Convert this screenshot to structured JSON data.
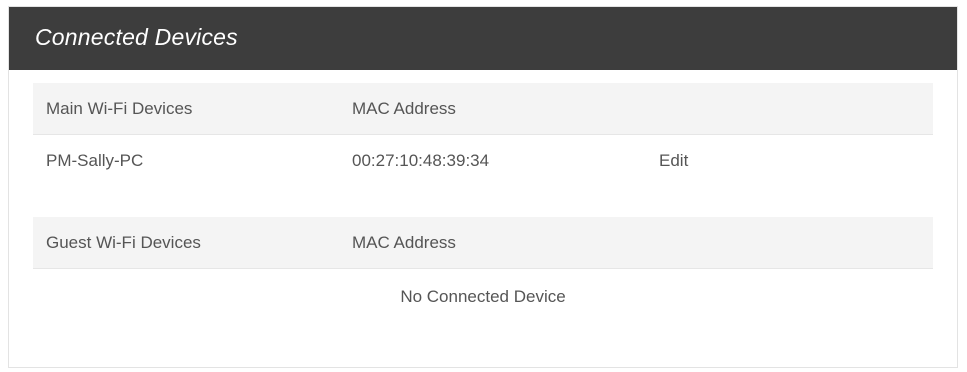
{
  "panel": {
    "title": "Connected Devices"
  },
  "main_wifi": {
    "header": {
      "device_col": "Main Wi-Fi Devices",
      "mac_col": "MAC Address"
    },
    "devices": [
      {
        "name": "PM-Sally-PC",
        "mac": "00:27:10:48:39:34",
        "action": "Edit"
      }
    ]
  },
  "guest_wifi": {
    "header": {
      "device_col": "Guest Wi-Fi Devices",
      "mac_col": "MAC Address"
    },
    "empty_message": "No Connected Device"
  }
}
